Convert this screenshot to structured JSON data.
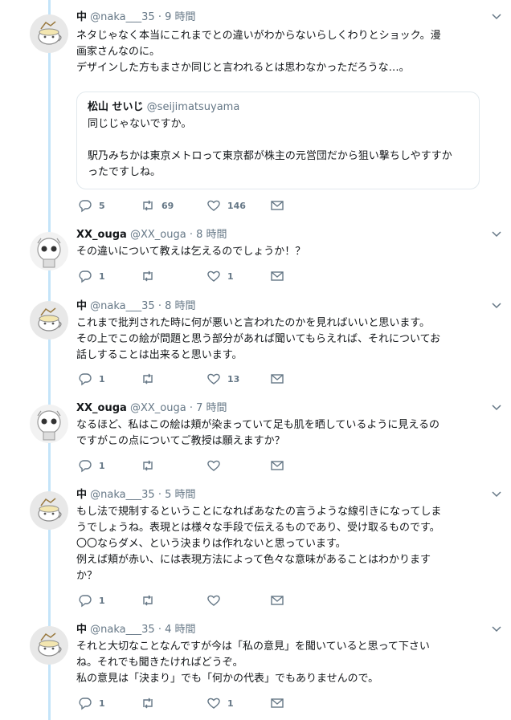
{
  "colors": {
    "thread_line": "#c4e4f9",
    "text": "#14171a",
    "muted": "#657786",
    "border": "#e1e8ed"
  },
  "tweets": [
    {
      "name": "中",
      "handle": "@naka___35",
      "dot": "·",
      "time": "9 時間",
      "avatar": "mug-avatar",
      "text": "ネタじゃなく本当にこれまでとの違いがわからないらしくわりとショック。漫\n画家さんなのに。\nデザインした方もまさか同じと言われるとは思わなかっただろうな…。",
      "quote": {
        "name": "松山 せいじ",
        "handle": "@seijimatsuyama",
        "text": "同じじゃないですか。\n\n駅乃みちかは東京メトロって東京都が株主の元営団だから狙い撃ちしやすすか\nったですしね。"
      },
      "replies": "5",
      "retweets": "69",
      "likes": "146"
    },
    {
      "name": "XX_ouga",
      "handle": "@XX_ouga",
      "dot": "·",
      "time": "8 時間",
      "avatar": "robot-avatar",
      "text": "その違いについて教えは乞えるのでしょうか！？",
      "replies": "1",
      "retweets": "",
      "likes": "1"
    },
    {
      "name": "中",
      "handle": "@naka___35",
      "dot": "·",
      "time": "8 時間",
      "avatar": "mug-avatar",
      "text": "これまで批判された時に何が悪いと言われたのかを見ればいいと思います。\nその上でこの絵が問題と思う部分があれば聞いてもらえれば、それについてお\n話しすることは出来ると思います。",
      "replies": "1",
      "retweets": "",
      "likes": "13"
    },
    {
      "name": "XX_ouga",
      "handle": "@XX_ouga",
      "dot": "·",
      "time": "7 時間",
      "avatar": "robot-avatar",
      "text": "なるほど、私はこの絵は頬が染まっていて足も肌を晒しているように見えるの\nですがこの点についてご教授は願えますか？",
      "replies": "1",
      "retweets": "",
      "likes": ""
    },
    {
      "name": "中",
      "handle": "@naka___35",
      "dot": "·",
      "time": "5 時間",
      "avatar": "mug-avatar",
      "text": "もし法で規制するということになればあなたの言うような線引きになってしま\nうでしょうね。表現とは様々な手段で伝えるものであり、受け取るものです。\n〇〇ならダメ、という決まりは作れないと思っています。\n例えば頬が赤い、には表現方法によって色々な意味があることはわかります\nか？",
      "replies": "1",
      "retweets": "",
      "likes": ""
    },
    {
      "name": "中",
      "handle": "@naka___35",
      "dot": "·",
      "time": "4 時間",
      "avatar": "mug-avatar",
      "text": "それと大切なことなんですが今は「私の意見」を聞いていると思って下さい\nね。それでも聞きたければどうぞ。\n私の意見は「決まり」でも「何かの代表」でもありませんので。",
      "replies": "1",
      "retweets": "",
      "likes": "1"
    }
  ]
}
